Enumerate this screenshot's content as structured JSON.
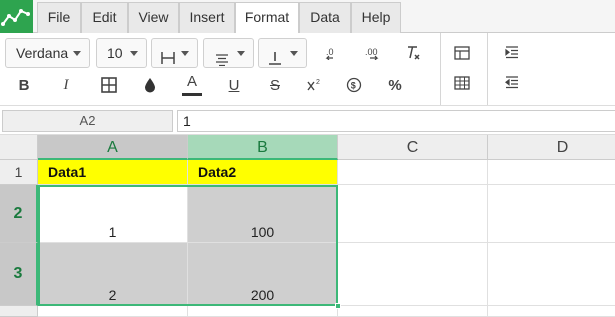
{
  "menu": {
    "items": [
      {
        "label": "File"
      },
      {
        "label": "Edit"
      },
      {
        "label": "View"
      },
      {
        "label": "Insert"
      },
      {
        "label": "Format",
        "active": true
      },
      {
        "label": "Data"
      },
      {
        "label": "Help"
      }
    ]
  },
  "toolbar": {
    "font_family": "Verdana",
    "font_size": "10",
    "bold_label": "B",
    "italic_label": "I",
    "percent_label": "%",
    "text_color": "#222222",
    "fill_color_hint": "#333333"
  },
  "formula_bar": {
    "cell_ref": "A2",
    "value": "1"
  },
  "sheet": {
    "columns": [
      "A",
      "B",
      "C",
      "D"
    ],
    "rows": [
      "1",
      "2",
      "3"
    ],
    "cells": {
      "A1": "Data1",
      "B1": "Data2",
      "A2": "1",
      "B2": "100",
      "A3": "2",
      "B3": "200"
    },
    "header_fill": "#ffff00",
    "selection_color": "#3cb878"
  }
}
